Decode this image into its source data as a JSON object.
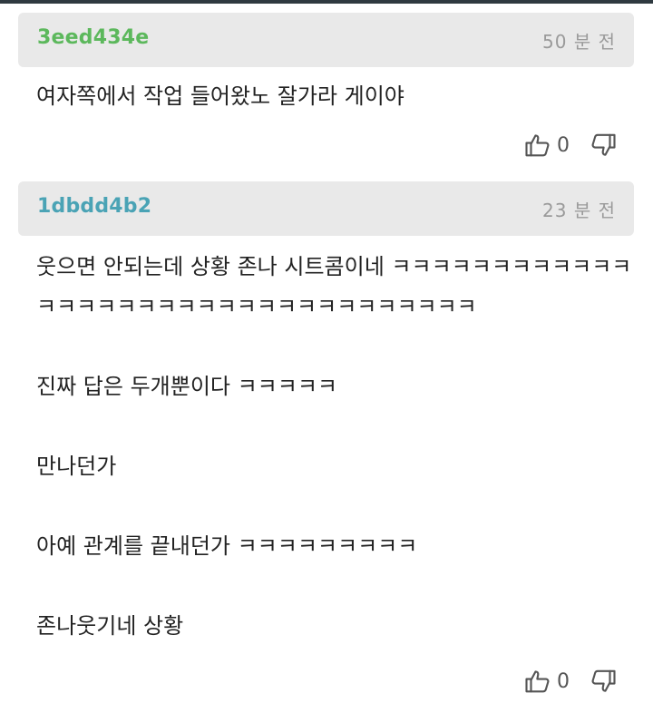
{
  "comments": [
    {
      "author": "3eed434e",
      "author_color": "#5cb85c",
      "time": "50 분 전",
      "text": "여자쪽에서 작업 들어왔노 잘가라 게이야",
      "likes": "0"
    },
    {
      "author": "1dbdd4b2",
      "author_color": "#4aa3b5",
      "time": "23 분 전",
      "text": "웃으면 안되는데 상황 존나 시트콤이네 ㅋㅋㅋㅋㅋㅋㅋㅋㅋㅋㅋㅋㅋㅋㅋㅋㅋㅋㅋㅋㅋㅋㅋㅋㅋㅋㅋㅋㅋㅋㅋㅋㅋㅋ\n\n진짜 답은 두개뿐이다 ㅋㅋㅋㅋㅋ\n\n만나던가\n\n아예 관계를 끝내던가 ㅋㅋㅋㅋㅋㅋㅋㅋㅋ\n\n존나웃기네 상황",
      "likes": "0"
    }
  ],
  "icons": {
    "like": "thumbs-up-icon",
    "dislike": "thumbs-down-icon"
  }
}
